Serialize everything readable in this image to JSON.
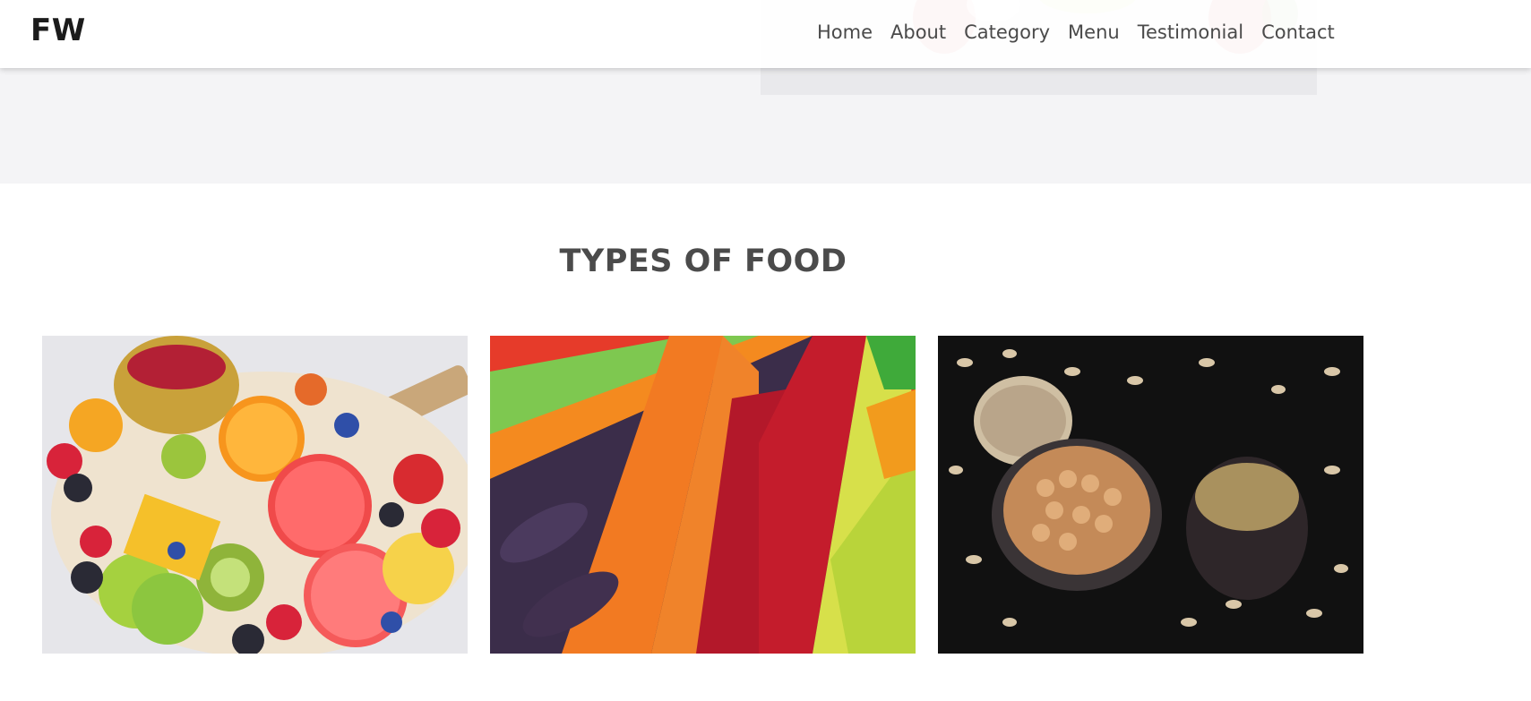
{
  "brand": {
    "logo_text": "FW"
  },
  "nav": {
    "items": [
      "Home",
      "About",
      "Category",
      "Menu",
      "Testimonial",
      "Contact"
    ]
  },
  "section": {
    "title": "TYPES OF FOOD"
  },
  "cards": [
    {
      "image": "fruit-platter-image"
    },
    {
      "image": "vegetable-market-image"
    },
    {
      "image": "grains-and-legumes-image"
    }
  ],
  "colors": {
    "hero_bg": "#f4f4f6",
    "text_dark": "#1b1b1b",
    "nav_text": "#4a4a4a"
  }
}
